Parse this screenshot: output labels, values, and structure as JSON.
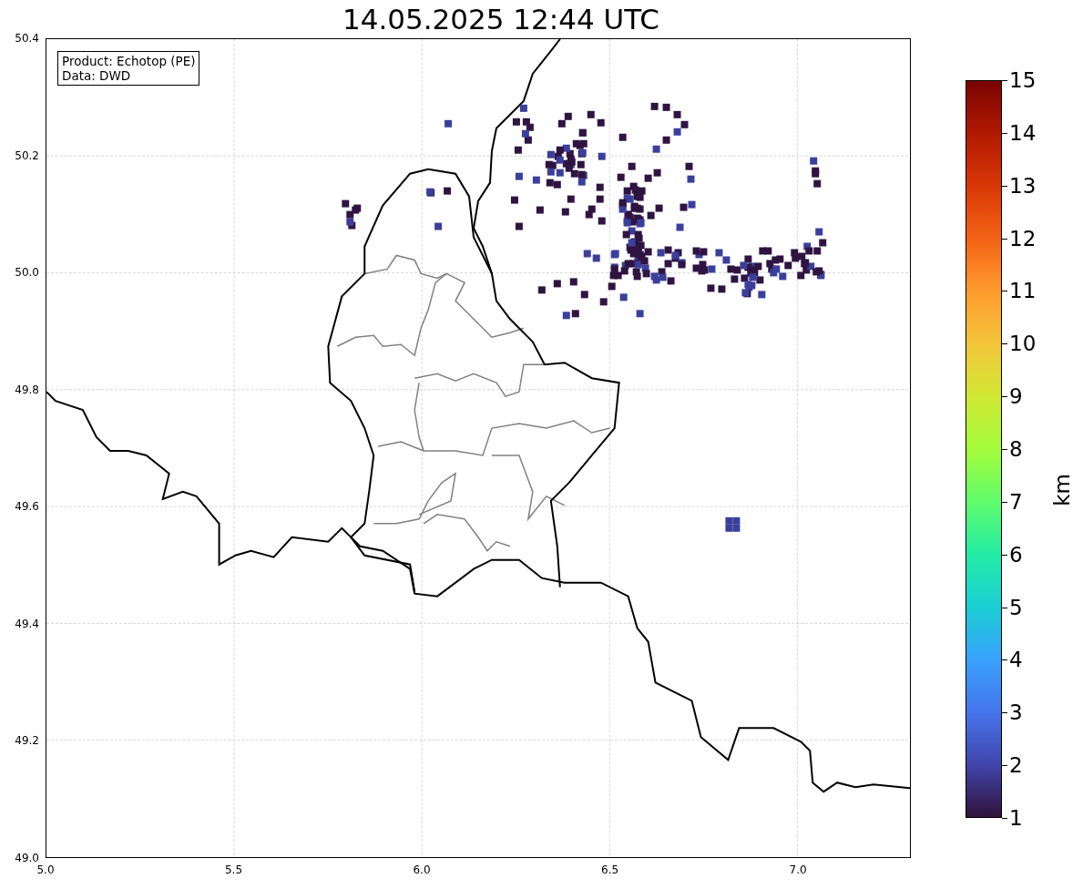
{
  "title": "14.05.2025 12:44 UTC",
  "legend": {
    "lines": [
      "Product: Echotop (PE)",
      "Data: DWD"
    ]
  },
  "map": {
    "xticks": [
      "5.0",
      "5.5",
      "6.0",
      "6.5",
      "7.0"
    ],
    "yticks": [
      "50.4",
      "50.2",
      "50.0",
      "49.8",
      "49.6",
      "49.4",
      "49.2",
      "49.0"
    ]
  },
  "colorbar": {
    "label": "km",
    "ticks": [
      "15",
      "14",
      "13",
      "12",
      "11",
      "10",
      "9",
      "8",
      "7",
      "6",
      "5",
      "4",
      "3",
      "2",
      "1"
    ]
  }
}
